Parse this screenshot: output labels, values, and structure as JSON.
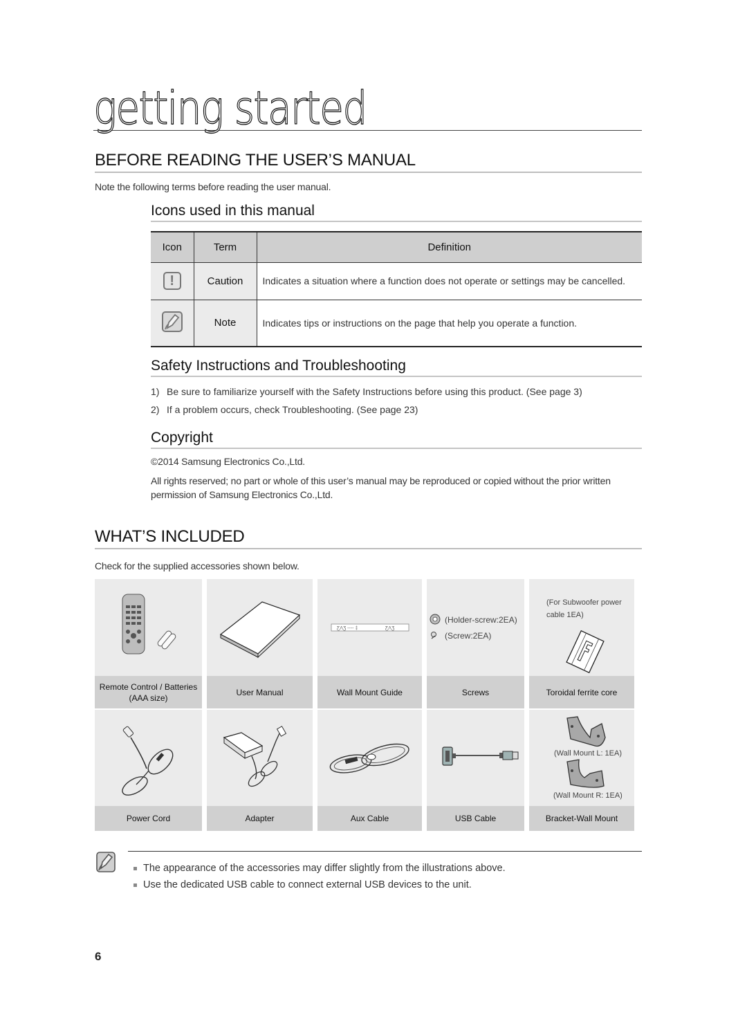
{
  "chapter": {
    "title": "getting started"
  },
  "before_reading": {
    "heading": "BEFORE READING THE USER’S MANUAL",
    "intro": "Note the following terms before reading the user manual.",
    "icons_section": {
      "heading": "Icons used in this manual",
      "columns": [
        "Icon",
        "Term",
        "Definition"
      ],
      "rows": [
        {
          "icon": "caution-icon",
          "term": "Caution",
          "definition": "Indicates a situation where a function does not operate or settings may be cancelled."
        },
        {
          "icon": "note-icon",
          "term": "Note",
          "definition": "Indicates tips or instructions on the page that help you operate a function."
        }
      ]
    },
    "safety_section": {
      "heading": "Safety Instructions and Troubleshooting",
      "items": [
        {
          "num": "1)",
          "text": "Be sure to familiarize yourself with the Safety Instructions before using this product. (See page 3)"
        },
        {
          "num": "2)",
          "text": "If a problem occurs, check Troubleshooting. (See page 23)"
        }
      ]
    },
    "copyright_section": {
      "heading": "Copyright",
      "line1": "©2014 Samsung Electronics Co.,Ltd.",
      "line2": "All rights reserved; no part or whole of this user’s manual may be reproduced or copied without the prior written permission of Samsung Electronics Co.,Ltd."
    }
  },
  "whats_included": {
    "heading": "WHAT’S INCLUDED",
    "intro": "Check for the supplied accessories shown below.",
    "row1": [
      {
        "label": "Remote Control / Batteries (AAA size)",
        "icon": "remote-control-icon"
      },
      {
        "label": "User Manual",
        "icon": "user-manual-icon"
      },
      {
        "label": "Wall Mount Guide",
        "icon": "wall-mount-guide-icon"
      },
      {
        "label": "Screws",
        "icon": "screws-icon",
        "notes": [
          "(Holder-screw:2EA)",
          "(Screw:2EA)"
        ]
      },
      {
        "label": "Toroidal ferrite core",
        "icon": "ferrite-core-icon",
        "notes": [
          "(For Subwoofer power",
          "cable 1EA)"
        ]
      }
    ],
    "row2": [
      {
        "label": "Power Cord",
        "icon": "power-cord-icon"
      },
      {
        "label": "Adapter",
        "icon": "adapter-icon"
      },
      {
        "label": "Aux Cable",
        "icon": "aux-cable-icon"
      },
      {
        "label": "USB Cable",
        "icon": "usb-cable-icon"
      },
      {
        "label": "Bracket-Wall Mount",
        "icon": "bracket-wall-mount-icon",
        "notes": [
          "(Wall Mount L: 1EA)",
          "(Wall Mount R: 1EA)"
        ]
      }
    ],
    "notes": [
      "The appearance of the accessories may differ slightly from the illustrations above.",
      "Use the dedicated USB cable to connect external USB devices to the unit."
    ]
  },
  "page_number": "6"
}
